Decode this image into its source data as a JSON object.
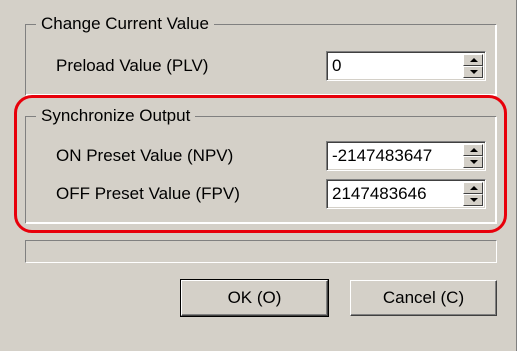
{
  "change_group": {
    "title": "Change Current Value",
    "preload_label": "Preload Value (PLV)",
    "preload_value": "0"
  },
  "sync_group": {
    "title": "Synchronize Output",
    "on_label": "ON Preset Value (NPV)",
    "on_value": "-2147483647",
    "off_label": "OFF Preset Value (FPV)",
    "off_value": "2147483646"
  },
  "buttons": {
    "ok": "OK (O)",
    "cancel": "Cancel (C)"
  },
  "colors": {
    "dialog_bg": "#d4d0c8",
    "highlight": "#e8000b"
  }
}
